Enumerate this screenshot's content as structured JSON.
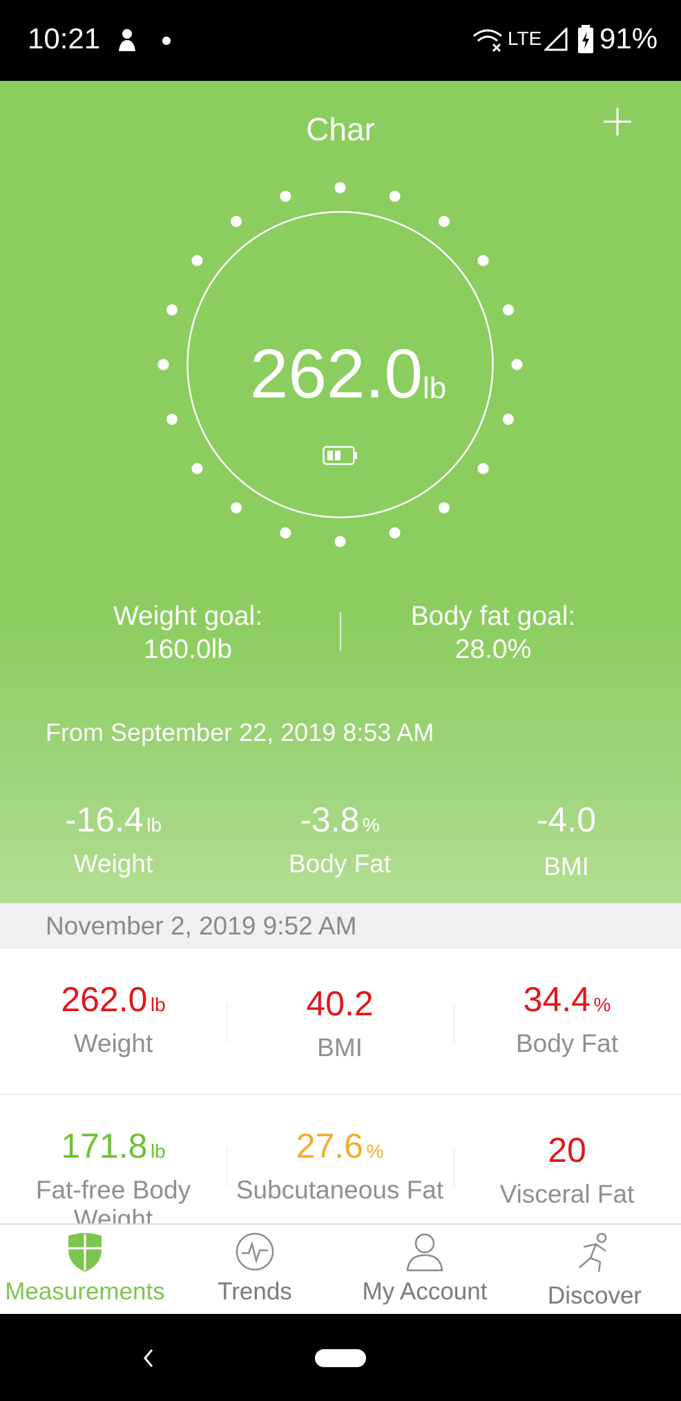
{
  "status_bar": {
    "time": "10:21",
    "network": "LTE",
    "battery_percent": "91%"
  },
  "header": {
    "profile_name": "Char",
    "add_icon": "plus-icon"
  },
  "current": {
    "weight": "262.0",
    "unit": "lb",
    "scale_battery_icon": "battery-icon"
  },
  "goals": {
    "weight_label": "Weight goal:",
    "weight_value": "160.0lb",
    "bodyfat_label": "Body fat goal:",
    "bodyfat_value": "28.0%"
  },
  "since": "From September 22, 2019 8:53 AM",
  "changes": [
    {
      "value": "-16.4",
      "unit": "lb",
      "label": "Weight"
    },
    {
      "value": "-3.8",
      "unit": "%",
      "label": "Body Fat"
    },
    {
      "value": "-4.0",
      "unit": "",
      "label": "BMI"
    }
  ],
  "record": {
    "date": "November 2, 2019 9:52 AM",
    "metrics": [
      {
        "value": "262.0",
        "unit": "lb",
        "label": "Weight",
        "color": "#e1161b"
      },
      {
        "value": "40.2",
        "unit": "",
        "label": "BMI",
        "color": "#e1161b"
      },
      {
        "value": "34.4",
        "unit": "%",
        "label": "Body Fat",
        "color": "#e1161b"
      },
      {
        "value": "171.8",
        "unit": "lb",
        "label": "Fat-free Body Weight",
        "color": "#6fc232"
      },
      {
        "value": "27.6",
        "unit": "%",
        "label": "Subcutaneous Fat",
        "color": "#f2ad2c"
      },
      {
        "value": "20",
        "unit": "",
        "label": "Visceral Fat",
        "color": "#e1161b"
      }
    ]
  },
  "nav": [
    {
      "label": "Measurements",
      "icon": "shield-icon",
      "active": true
    },
    {
      "label": "Trends",
      "icon": "pulse-icon",
      "active": false
    },
    {
      "label": "My Account",
      "icon": "person-icon",
      "active": false
    },
    {
      "label": "Discover",
      "icon": "running-person-icon",
      "active": false
    }
  ],
  "colors": {
    "brand_green": "#8bcd5f",
    "nav_active": "#7cc54e",
    "alert_red": "#e1161b"
  }
}
